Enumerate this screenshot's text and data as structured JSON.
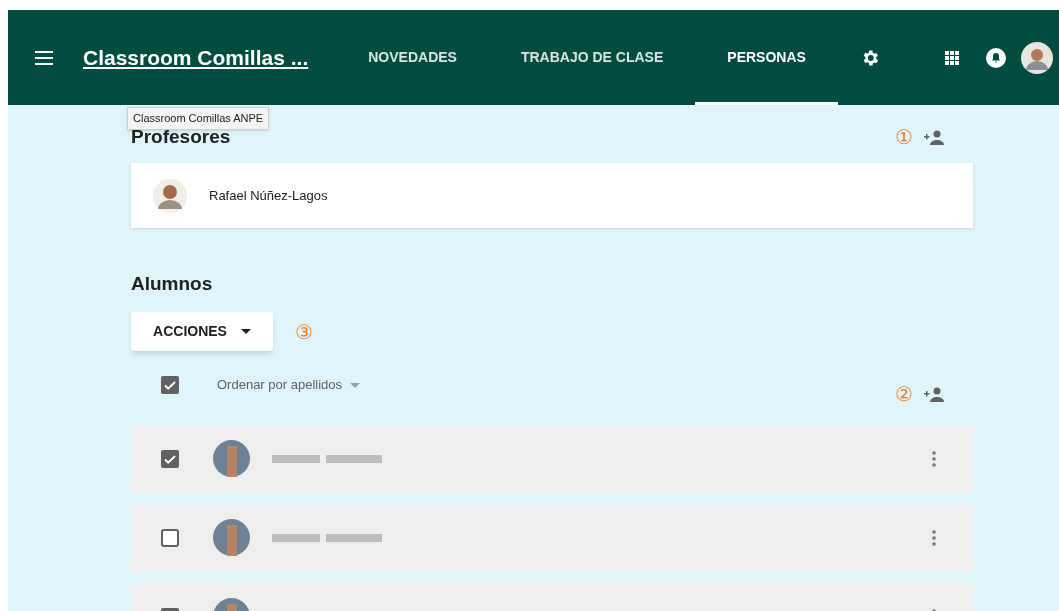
{
  "header": {
    "course_title": "Classroom Comillas ...",
    "tabs": [
      {
        "label": "NOVEDADES",
        "selected": false
      },
      {
        "label": "TRABAJO DE CLASE",
        "selected": false
      },
      {
        "label": "PERSONAS",
        "selected": true
      }
    ]
  },
  "tooltip": "Classroom Comillas ANPE",
  "teachers": {
    "title": "Profesores",
    "marker": "①",
    "people": [
      {
        "name": "Rafael Núñez-Lagos"
      }
    ]
  },
  "students": {
    "title": "Alumnos",
    "actions_button": "ACCIONES",
    "actions_marker": "③",
    "select_all_checked": true,
    "sort_label": "Ordenar por apellidos",
    "add_marker": "②",
    "rows": [
      {
        "checked": true
      },
      {
        "checked": false
      },
      {
        "checked": true
      }
    ]
  }
}
